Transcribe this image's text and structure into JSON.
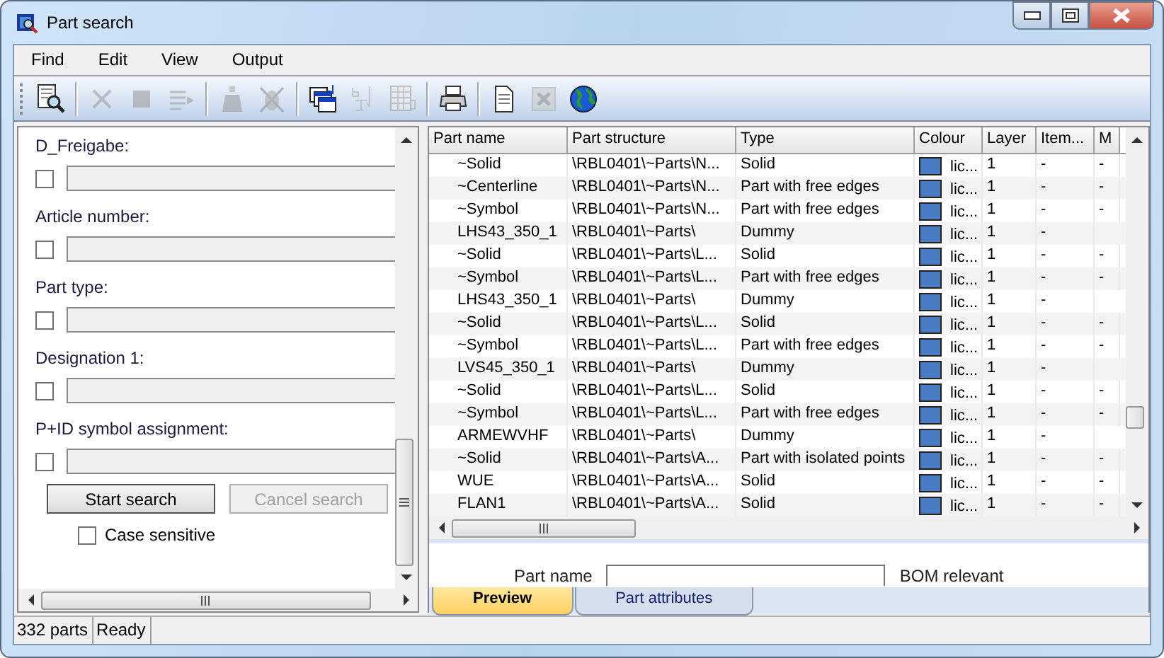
{
  "window": {
    "title": "Part search"
  },
  "menu": [
    "Find",
    "Edit",
    "View",
    "Output"
  ],
  "toolbar": [
    {
      "kind": "preview",
      "disabled": false
    },
    {
      "kind": "sep"
    },
    {
      "kind": "cross",
      "disabled": true
    },
    {
      "kind": "stop",
      "disabled": true
    },
    {
      "kind": "listarrow",
      "disabled": true
    },
    {
      "kind": "sep"
    },
    {
      "kind": "weight",
      "disabled": true
    },
    {
      "kind": "bug",
      "disabled": true
    },
    {
      "kind": "sep"
    },
    {
      "kind": "windows",
      "disabled": false
    },
    {
      "kind": "abc",
      "disabled": true
    },
    {
      "kind": "table",
      "disabled": true
    },
    {
      "kind": "sep"
    },
    {
      "kind": "printer",
      "disabled": false
    },
    {
      "kind": "sep"
    },
    {
      "kind": "document",
      "disabled": false
    },
    {
      "kind": "closebox",
      "disabled": true
    },
    {
      "kind": "globe",
      "disabled": false
    }
  ],
  "search_form": {
    "fields": [
      {
        "label": "D_Freigabe:",
        "checked": false
      },
      {
        "label": "Article number:",
        "checked": false
      },
      {
        "label": "Part type:",
        "checked": false
      },
      {
        "label": "Designation 1:",
        "checked": false
      },
      {
        "label": "P+ID symbol assignment:",
        "checked": false
      }
    ],
    "buttons": [
      {
        "label": "Start search",
        "disabled": false
      },
      {
        "label": "Cancel search",
        "disabled": true
      }
    ],
    "case_sensitive": {
      "label": "Case sensitive",
      "checked": false
    }
  },
  "table": {
    "columns": [
      "Part name",
      "Part structure",
      "Type",
      "Colour",
      "Layer",
      "Item...",
      "M"
    ],
    "rows": [
      {
        "cells": [
          "~Solid",
          "\\RBL0401\\~Parts\\N...",
          "Solid",
          "lic...",
          "1",
          "-",
          "-"
        ],
        "color": "#4a7cc4"
      },
      {
        "cells": [
          "~Centerline",
          "\\RBL0401\\~Parts\\N...",
          "Part with free edges",
          "lic...",
          "1",
          "-",
          "-"
        ],
        "color": "#4a7cc4"
      },
      {
        "cells": [
          "~Symbol",
          "\\RBL0401\\~Parts\\N...",
          "Part with free edges",
          "lic...",
          "1",
          "-",
          "-"
        ],
        "color": "#4a7cc4"
      },
      {
        "cells": [
          "LHS43_350_1",
          "\\RBL0401\\~Parts\\",
          "Dummy",
          "lic...",
          "1",
          "-"
        ],
        "color": "#4a7cc4"
      },
      {
        "cells": [
          "~Solid",
          "\\RBL0401\\~Parts\\L...",
          "Solid",
          "lic...",
          "1",
          "-",
          "-"
        ],
        "color": "#4a7cc4"
      },
      {
        "cells": [
          "~Symbol",
          "\\RBL0401\\~Parts\\L...",
          "Part with free edges",
          "lic...",
          "1",
          "-",
          "-"
        ],
        "color": "#4a7cc4"
      },
      {
        "cells": [
          "LHS43_350_1",
          "\\RBL0401\\~Parts\\",
          "Dummy",
          "lic...",
          "1",
          "-"
        ],
        "color": "#4a7cc4"
      },
      {
        "cells": [
          "~Solid",
          "\\RBL0401\\~Parts\\L...",
          "Solid",
          "lic...",
          "1",
          "-",
          "-"
        ],
        "color": "#4a7cc4"
      },
      {
        "cells": [
          "~Symbol",
          "\\RBL0401\\~Parts\\L...",
          "Part with free edges",
          "lic...",
          "1",
          "-",
          "-"
        ],
        "color": "#4a7cc4"
      },
      {
        "cells": [
          "LVS45_350_1",
          "\\RBL0401\\~Parts\\",
          "Dummy",
          "lic...",
          "1",
          "-"
        ],
        "color": "#4a7cc4"
      },
      {
        "cells": [
          "~Solid",
          "\\RBL0401\\~Parts\\L...",
          "Solid",
          "lic...",
          "1",
          "-",
          "-"
        ],
        "color": "#4a7cc4"
      },
      {
        "cells": [
          "~Symbol",
          "\\RBL0401\\~Parts\\L...",
          "Part with free edges",
          "lic...",
          "1",
          "-",
          "-"
        ],
        "color": "#4a7cc4"
      },
      {
        "cells": [
          "ARMEWVHF",
          "\\RBL0401\\~Parts\\",
          "Dummy",
          "lic...",
          "1",
          "-"
        ],
        "color": "#4a7cc4"
      },
      {
        "cells": [
          "~Solid",
          "\\RBL0401\\~Parts\\A...",
          "Part with isolated points",
          "lic...",
          "1",
          "-",
          "-"
        ],
        "color": "#4a7cc4"
      },
      {
        "cells": [
          "WUE",
          "\\RBL0401\\~Parts\\A...",
          "Solid",
          "lic...",
          "1",
          "-",
          "-"
        ],
        "color": "#4a7cc4"
      },
      {
        "cells": [
          "FLAN1",
          "\\RBL0401\\~Parts\\A...",
          "Solid",
          "lic...",
          "1",
          "-",
          "-"
        ],
        "color": "#4a7cc4"
      }
    ]
  },
  "preview": {
    "labels": [
      "Part name",
      "BOM relevant"
    ]
  },
  "tabs": [
    {
      "label": "Preview",
      "selected": true
    },
    {
      "label": "Part attributes",
      "selected": false
    }
  ],
  "status_bar": [
    "332 parts",
    "Ready"
  ]
}
